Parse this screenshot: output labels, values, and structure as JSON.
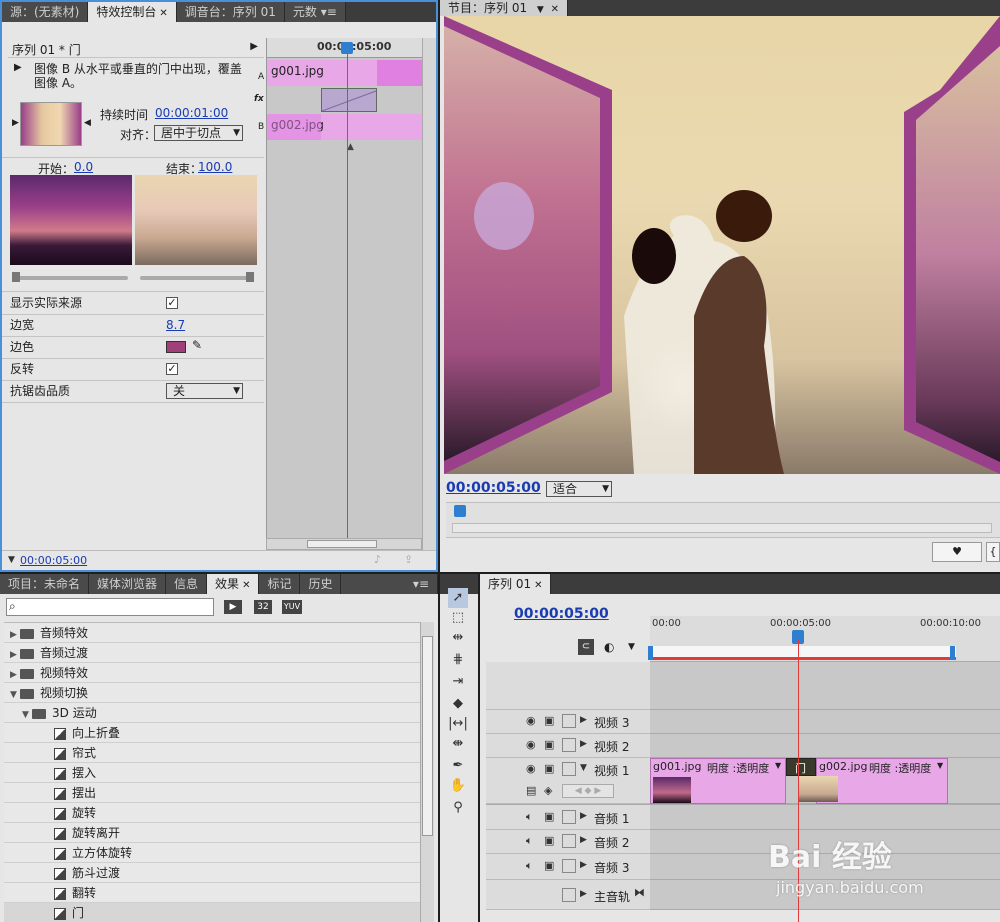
{
  "top_left_tabs": [
    "源：(无素材)",
    "特效控制台",
    "调音台：序列 01",
    "元数"
  ],
  "effect_controls": {
    "header": "序列 01 * 门",
    "description": "图像 B 从水平或垂直的门中出现，覆盖图像 A。",
    "duration_label": "持续时间",
    "duration_value": "00:00:01:00",
    "align_label": "对齐：",
    "align_value": "居中于切点",
    "start_label": "开始：",
    "start_value": "0.0",
    "end_label": "结束：",
    "end_value": "100.0",
    "timecode_ruler": "00:00:05:00",
    "clip_a": "g001.jpg",
    "clip_b": "g002.jpg",
    "label_a": "A",
    "label_b": "B",
    "fx_label": "fx",
    "props": [
      {
        "label": "显示实际来源",
        "type": "checkbox",
        "checked": "✓"
      },
      {
        "label": "边宽",
        "type": "value",
        "value": "8.7"
      },
      {
        "label": "边色",
        "type": "color",
        "color": "#a0407a"
      },
      {
        "label": "反转",
        "type": "checkbox",
        "checked": "✓"
      },
      {
        "label": "抗锯齿品质",
        "type": "dropdown",
        "value": "关"
      }
    ],
    "footer_timecode": "00:00:05:00"
  },
  "program_monitor": {
    "tab": "节目：序列 01",
    "timecode": "00:00:05:00",
    "fit_value": "适合"
  },
  "bottom_left_tabs": [
    "项目：未命名",
    "媒体浏览器",
    "信息",
    "效果",
    "标记",
    "历史"
  ],
  "effects_panel": {
    "search_placeholder": "",
    "badge_32": "32",
    "badge_yuv": "YUV",
    "tree": [
      {
        "indent": 0,
        "expanded": "▶",
        "folder": true,
        "label": "音频特效"
      },
      {
        "indent": 0,
        "expanded": "▶",
        "folder": true,
        "label": "音频过渡"
      },
      {
        "indent": 0,
        "expanded": "▶",
        "folder": true,
        "label": "视频特效"
      },
      {
        "indent": 0,
        "expanded": "▼",
        "folder": true,
        "label": "视频切换"
      },
      {
        "indent": 1,
        "expanded": "▼",
        "folder": true,
        "label": "3D 运动"
      },
      {
        "indent": 2,
        "expanded": "",
        "folder": false,
        "label": "向上折叠"
      },
      {
        "indent": 2,
        "expanded": "",
        "folder": false,
        "label": "帘式"
      },
      {
        "indent": 2,
        "expanded": "",
        "folder": false,
        "label": "摆入"
      },
      {
        "indent": 2,
        "expanded": "",
        "folder": false,
        "label": "摆出"
      },
      {
        "indent": 2,
        "expanded": "",
        "folder": false,
        "label": "旋转"
      },
      {
        "indent": 2,
        "expanded": "",
        "folder": false,
        "label": "旋转离开"
      },
      {
        "indent": 2,
        "expanded": "",
        "folder": false,
        "label": "立方体旋转"
      },
      {
        "indent": 2,
        "expanded": "",
        "folder": false,
        "label": "筋斗过渡"
      },
      {
        "indent": 2,
        "expanded": "",
        "folder": false,
        "label": "翻转"
      },
      {
        "indent": 2,
        "expanded": "",
        "folder": false,
        "label": "门"
      }
    ]
  },
  "timeline": {
    "tab": "序列 01",
    "timecode": "00:00:05:00",
    "ruler": [
      "00:00",
      "00:00:05:00",
      "00:00:10:00"
    ],
    "tracks": [
      {
        "name": "视频 3",
        "kind": "video"
      },
      {
        "name": "视频 2",
        "kind": "video"
      },
      {
        "name": "视频 1",
        "kind": "video"
      },
      {
        "name": "音频 1",
        "kind": "audio"
      },
      {
        "name": "音频 2",
        "kind": "audio"
      },
      {
        "name": "音频 3",
        "kind": "audio"
      },
      {
        "name": "主音轨",
        "kind": "master"
      }
    ],
    "clip1_name": "g001.jpg",
    "clip1_fx": "明度 :透明度",
    "clip2_name": "g002.jpg",
    "clip2_fx": "明度 :透明度",
    "transition_label": "门"
  },
  "watermark": {
    "brand": "Bai 经验",
    "url": "jingyan.baidu.com"
  },
  "colors": {
    "playhead": "#e03a3a",
    "clip_pink": "#e8a8e8",
    "timecode_blue": "#1a3cb0"
  }
}
